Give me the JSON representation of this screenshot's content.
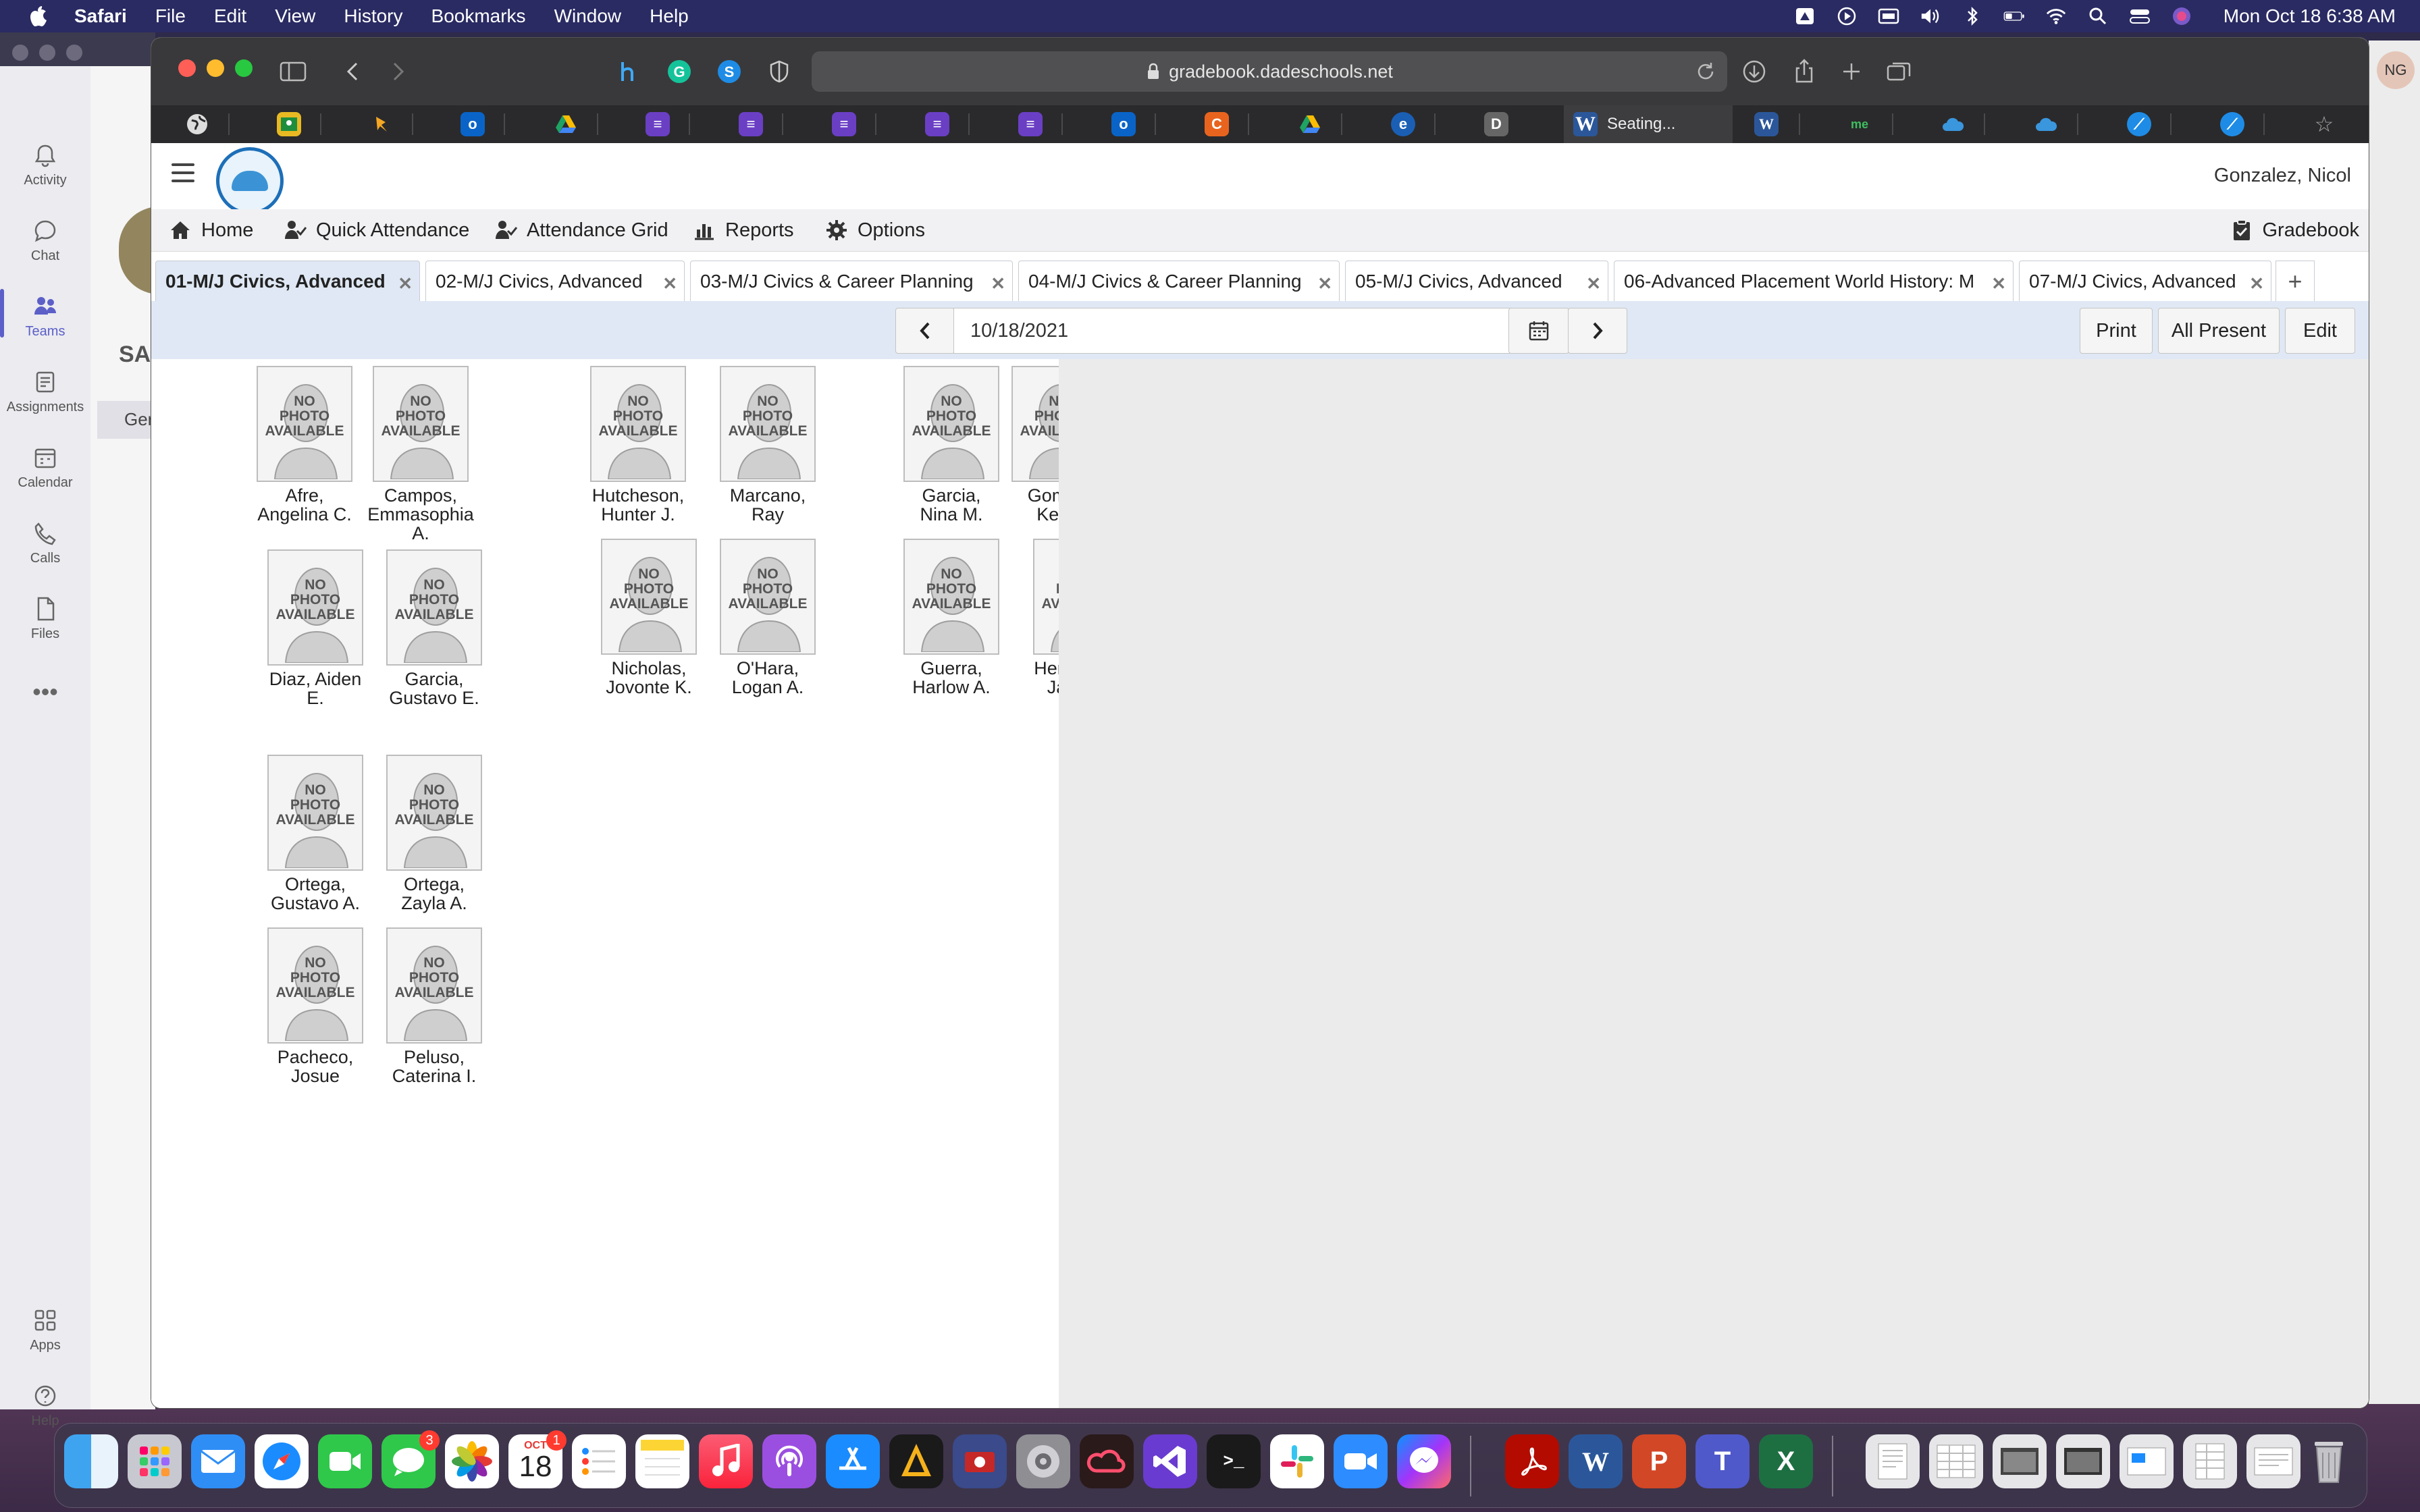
{
  "menubar": {
    "app": "Safari",
    "items": [
      "File",
      "Edit",
      "View",
      "History",
      "Bookmarks",
      "Window",
      "Help"
    ],
    "clock": "Mon Oct 18  6:38 AM"
  },
  "teams": {
    "rail": [
      "Activity",
      "Chat",
      "Teams",
      "Assignments",
      "Calendar",
      "Calls",
      "Files",
      "Apps",
      "Help"
    ],
    "sa_text": "SA",
    "gen_text": "Ger",
    "avatar": "NG"
  },
  "browser": {
    "url": "gradebook.dadeschools.net",
    "active_tab_title": "Seating..."
  },
  "page": {
    "user": "Gonzalez, Nicol",
    "nav": {
      "home": "Home",
      "quick_attendance": "Quick Attendance",
      "attendance_grid": "Attendance Grid",
      "reports": "Reports",
      "options": "Options",
      "gradebook": "Gradebook"
    },
    "tabs": [
      "01-M/J Civics, Advanced",
      "02-M/J Civics, Advanced",
      "03-M/J Civics & Career Planning",
      "04-M/J Civics & Career Planning",
      "05-M/J Civics, Advanced",
      "06-Advanced Placement World History: M",
      "07-M/J Civics, Advanced"
    ],
    "tab_add": "+",
    "date": "10/18/2021",
    "buttons": {
      "print": "Print",
      "all_present": "All Present",
      "edit": "Edit"
    },
    "photo_placeholder": [
      "NO",
      "PHOTO",
      "AVAILABLE"
    ],
    "students": [
      {
        "line1": "Afre,",
        "line2": "Angelina C.",
        "line3": ""
      },
      {
        "line1": "Campos,",
        "line2": "Emmasophia",
        "line3": "A."
      },
      {
        "line1": "Hutcheson,",
        "line2": "Hunter J.",
        "line3": ""
      },
      {
        "line1": "Marcano,",
        "line2": "Ray",
        "line3": ""
      },
      {
        "line1": "Garcia,",
        "line2": "Nina M.",
        "line3": ""
      },
      {
        "line1": "Gomez,",
        "line2": "Kevin",
        "line3": ""
      },
      {
        "line1": "Diaz, Aiden",
        "line2": "E.",
        "line3": ""
      },
      {
        "line1": "Garcia,",
        "line2": "Gustavo E.",
        "line3": ""
      },
      {
        "line1": "Nicholas,",
        "line2": "Jovonte K.",
        "line3": ""
      },
      {
        "line1": "O'Hara,",
        "line2": "Logan A.",
        "line3": ""
      },
      {
        "line1": "Guerra,",
        "line2": "Harlow A.",
        "line3": ""
      },
      {
        "line1": "Hernandez,",
        "line2": "Jazmine",
        "line3": ""
      },
      {
        "line1": "Ortega,",
        "line2": "Gustavo A.",
        "line3": ""
      },
      {
        "line1": "Ortega,",
        "line2": "Zayla A.",
        "line3": ""
      },
      {
        "line1": "Pacheco,",
        "line2": "Josue",
        "line3": ""
      },
      {
        "line1": "Peluso,",
        "line2": "Caterina I.",
        "line3": ""
      }
    ]
  },
  "dock": {
    "calendar_month": "OCT",
    "calendar_day": "18",
    "messages_badge": "3",
    "calendar_badge": "1"
  }
}
